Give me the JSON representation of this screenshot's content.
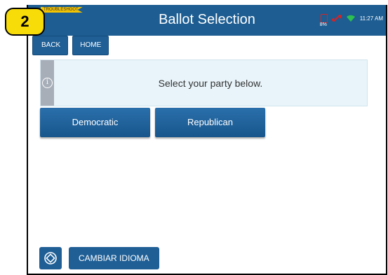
{
  "header": {
    "title": "Ballot Selection",
    "troubleshoot_label": "TROUBLESHOOT"
  },
  "status": {
    "battery_percent": "8%",
    "time": "11:27 AM",
    "battery_color": "#d22222",
    "link_color": "#e02020",
    "wifi_color": "#2dbf4f"
  },
  "nav": {
    "back_label": "BACK",
    "home_label": "HOME"
  },
  "info": {
    "message": "Select your party below.",
    "icon": "info-circle-icon"
  },
  "parties": [
    {
      "label": "Democratic"
    },
    {
      "label": "Republican"
    }
  ],
  "footer": {
    "rotate_icon": "rotate-screen-icon",
    "language_label": "CAMBIAR IDIOMA"
  },
  "callout": {
    "number": "2"
  },
  "colors": {
    "primary": "#1d5d92",
    "callout": "#f7dc0a",
    "info_bg": "#e8f4fa"
  }
}
